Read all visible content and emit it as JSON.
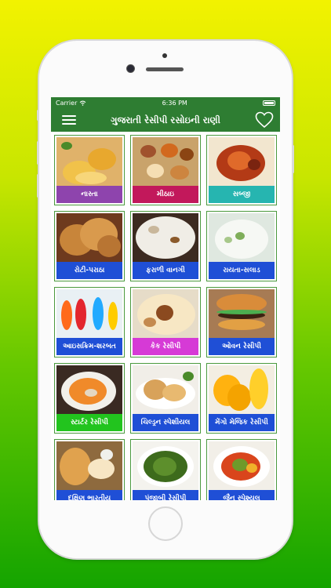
{
  "status_bar": {
    "carrier": "Carrier",
    "wifi_icon": "wifi-icon",
    "time": "6:36 PM",
    "battery_icon": "battery-icon"
  },
  "nav": {
    "title": "ગુજરાતી રેસીપી રસોઇની રાણી",
    "menu_icon": "hamburger-menu-icon",
    "favorite_icon": "heart-icon"
  },
  "colors": {
    "nav_bar": "#2e7d32",
    "tile_border": "#4b9a3e"
  },
  "categories": [
    {
      "label": "નાસ્તા",
      "color": "#8e44ad",
      "photo": "dhokla"
    },
    {
      "label": "મીઠાઇ",
      "color": "#c2185b",
      "photo": "sweets"
    },
    {
      "label": "સબ્જી",
      "color": "#26b5b0",
      "photo": "curry"
    },
    {
      "label": "રોટી-પરાઠા",
      "color": "#1f4fd6",
      "photo": "paratha"
    },
    {
      "label": "ફરાળી વાનગી",
      "color": "#1f4fd6",
      "photo": "farali"
    },
    {
      "label": "રાયતા-સલાડ",
      "color": "#1f4fd6",
      "photo": "raita"
    },
    {
      "label": "આઇસક્રિમ-શરબત",
      "color": "#1f4fd6",
      "photo": "drinks"
    },
    {
      "label": "કેક રેસીપી",
      "color": "#d63ad6",
      "photo": "cake"
    },
    {
      "label": "ઓવન રેસીપી",
      "color": "#1f4fd6",
      "photo": "burger"
    },
    {
      "label": "સ્ટાર્ટર રેસીપી",
      "color": "#22c41e",
      "photo": "soup"
    },
    {
      "label": "ચિલ્ડ્રન સ્પેશીયલ",
      "color": "#1f4fd6",
      "photo": "sandwich"
    },
    {
      "label": "મેંગો મેજિક રેસીપી",
      "color": "#1f4fd6",
      "photo": "mango"
    },
    {
      "label": "દક્ષિણ ભારતીય",
      "color": "#1f4fd6",
      "photo": "dosa"
    },
    {
      "label": "પંજાબી રેસીપી",
      "color": "#1f4fd6",
      "photo": "palak"
    },
    {
      "label": "જૈન સ્પેશ્યલ",
      "color": "#1f4fd6",
      "photo": "jain"
    }
  ]
}
